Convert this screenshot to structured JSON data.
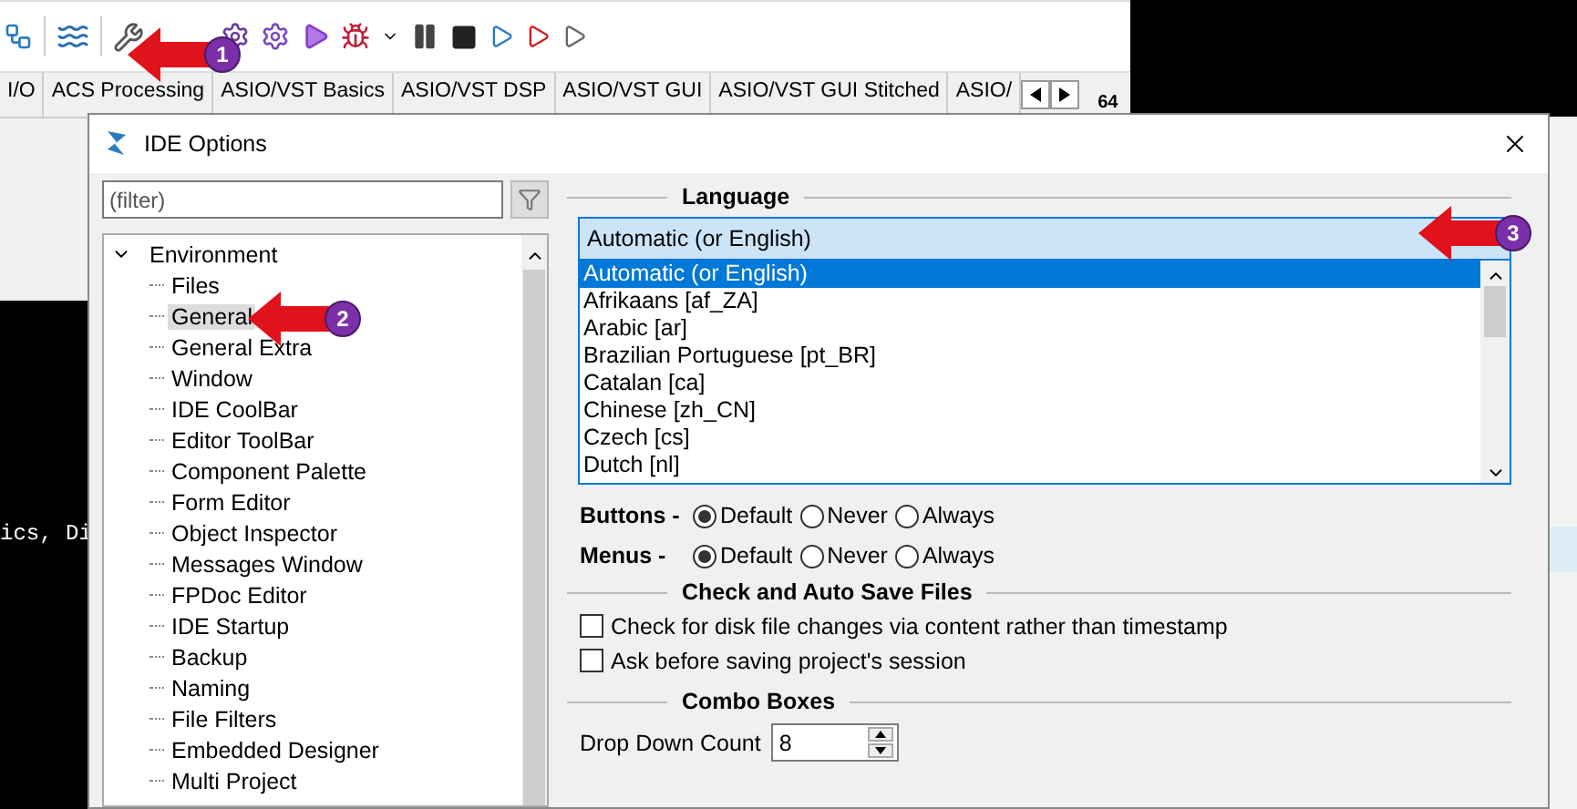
{
  "ide_tabs": [
    {
      "label": "I/O",
      "selected": false
    },
    {
      "label": "ACS Processing",
      "selected": false
    },
    {
      "label": "ASIO/VST Basics",
      "selected": false
    },
    {
      "label": "ASIO/VST DSP",
      "selected": false
    },
    {
      "label": "ASIO/VST GUI",
      "selected": false
    },
    {
      "label": "ASIO/VST GUI Stitched",
      "selected": false
    },
    {
      "label": "ASIO/",
      "selected": false
    }
  ],
  "platform_badge": "64",
  "terminal": {
    "text": "ics, Di"
  },
  "dialog": {
    "title": "IDE Options",
    "filter": {
      "placeholder": "(filter)"
    },
    "tree": [
      {
        "label": "Environment",
        "expanded": true,
        "selected": false,
        "children": [
          {
            "label": "Files",
            "selected": false
          },
          {
            "label": "General",
            "selected": true
          },
          {
            "label": "General Extra",
            "selected": false
          },
          {
            "label": "Window",
            "selected": false
          },
          {
            "label": "IDE CoolBar",
            "selected": false
          },
          {
            "label": "Editor ToolBar",
            "selected": false
          },
          {
            "label": "Component Palette",
            "selected": false
          },
          {
            "label": "Form Editor",
            "selected": false
          },
          {
            "label": "Object Inspector",
            "selected": false
          },
          {
            "label": "Messages Window",
            "selected": false
          },
          {
            "label": "FPDoc Editor",
            "selected": false
          },
          {
            "label": "IDE Startup",
            "selected": false
          },
          {
            "label": "Backup",
            "selected": false
          },
          {
            "label": "Naming",
            "selected": false
          },
          {
            "label": "File Filters",
            "selected": false
          },
          {
            "label": "Embedded Designer",
            "selected": false
          },
          {
            "label": "Multi Project",
            "selected": false
          }
        ]
      }
    ],
    "language": {
      "heading": "Language",
      "value": "Automatic (or English)",
      "expanded": true,
      "options": [
        {
          "label": "Automatic (or English)",
          "selected": true
        },
        {
          "label": "Afrikaans [af_ZA]",
          "selected": false
        },
        {
          "label": "Arabic [ar]",
          "selected": false
        },
        {
          "label": "Brazilian Portuguese [pt_BR]",
          "selected": false
        },
        {
          "label": "Catalan [ca]",
          "selected": false
        },
        {
          "label": "Chinese [zh_CN]",
          "selected": false
        },
        {
          "label": "Czech [cs]",
          "selected": false
        },
        {
          "label": "Dutch [nl]",
          "selected": false
        }
      ]
    },
    "hint_rows": [
      {
        "label": "Buttons -",
        "options": [
          {
            "label": "Default",
            "selected": true
          },
          {
            "label": "Never",
            "selected": false
          },
          {
            "label": "Always",
            "selected": false
          }
        ]
      },
      {
        "label": "Menus -",
        "options": [
          {
            "label": "Default",
            "selected": true
          },
          {
            "label": "Never",
            "selected": false
          },
          {
            "label": "Always",
            "selected": false
          }
        ]
      }
    ],
    "check_and_auto_save": {
      "heading": "Check and Auto Save Files",
      "options": [
        {
          "label": "Check for disk file changes via content rather than timestamp",
          "checked": false
        },
        {
          "label": "Ask before saving project's session",
          "checked": false
        }
      ]
    },
    "combo_boxes": {
      "heading": "Combo Boxes",
      "drop_down_count": {
        "label": "Drop Down Count",
        "value": "8"
      }
    }
  },
  "annotations": [
    {
      "number": "1"
    },
    {
      "number": "2"
    },
    {
      "number": "3"
    }
  ]
}
